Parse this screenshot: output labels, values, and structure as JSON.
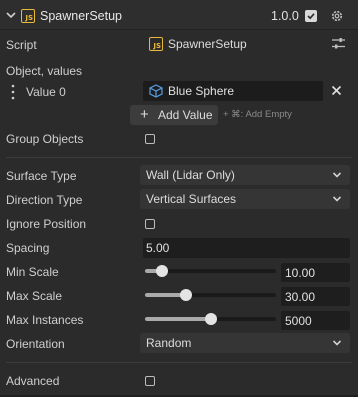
{
  "header": {
    "title": "SpawnerSetup",
    "version": "1.0.0",
    "badge_text": "JS",
    "enabled": true
  },
  "script": {
    "label": "Script",
    "value": "SpawnerSetup"
  },
  "objects": {
    "label": "Object, values",
    "items": [
      {
        "label": "Value 0",
        "value": "Blue Sphere"
      }
    ],
    "add_button": "Add Value",
    "add_hint": "+ ⌘: Add Empty"
  },
  "group_objects": {
    "label": "Group Objects",
    "checked": false
  },
  "surface_type": {
    "label": "Surface Type",
    "value": "Wall (Lidar Only)"
  },
  "direction_type": {
    "label": "Direction Type",
    "value": "Vertical Surfaces"
  },
  "ignore_position": {
    "label": "Ignore Position",
    "checked": false
  },
  "spacing": {
    "label": "Spacing",
    "value": "5.00"
  },
  "min_scale": {
    "label": "Min Scale",
    "value": "10.00",
    "slider_fraction": 0.13
  },
  "max_scale": {
    "label": "Max Scale",
    "value": "30.00",
    "slider_fraction": 0.31
  },
  "max_instances": {
    "label": "Max Instances",
    "value": "5000",
    "slider_fraction": 0.5
  },
  "orientation": {
    "label": "Orientation",
    "value": "Random"
  },
  "advanced": {
    "label": "Advanced",
    "checked": false
  },
  "colors": {
    "panel_bg": "#2b2b2b",
    "field_bg": "#1c1c1c",
    "dropdown_bg": "#353535",
    "js_badge": "#e9b93a",
    "cube_icon": "#5aa0e6"
  }
}
